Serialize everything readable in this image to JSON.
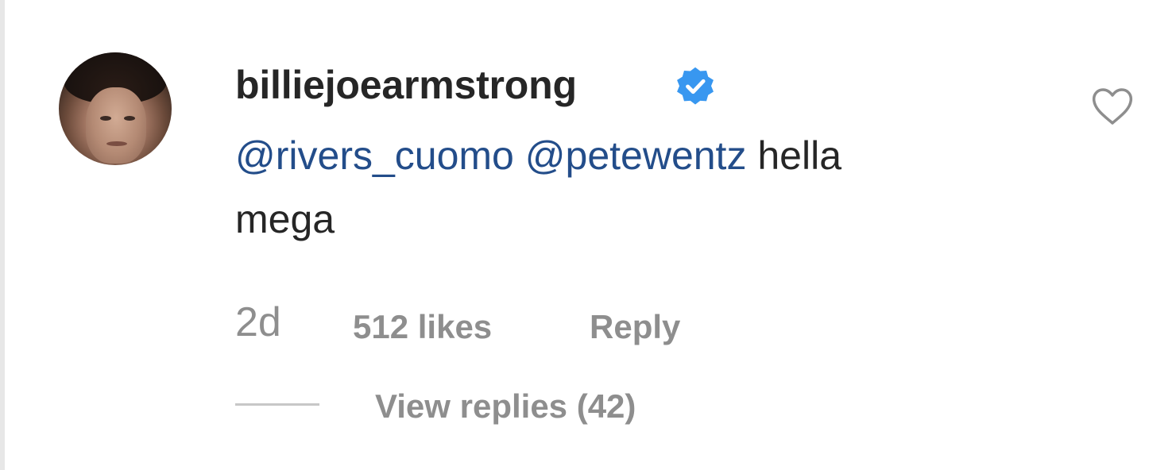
{
  "comment": {
    "username": "billiejoearmstrong",
    "verified_icon": "verified-badge-icon",
    "mention_1": "@rivers_cuomo",
    "mention_2": "@petewentz",
    "text_after_mentions": "hella",
    "text_line2": "mega",
    "time": "2d",
    "likes": "512 likes",
    "reply_label": "Reply",
    "view_replies_label": "View replies (42)",
    "accent_color": "#234d8a",
    "verified_color": "#3897f0"
  }
}
